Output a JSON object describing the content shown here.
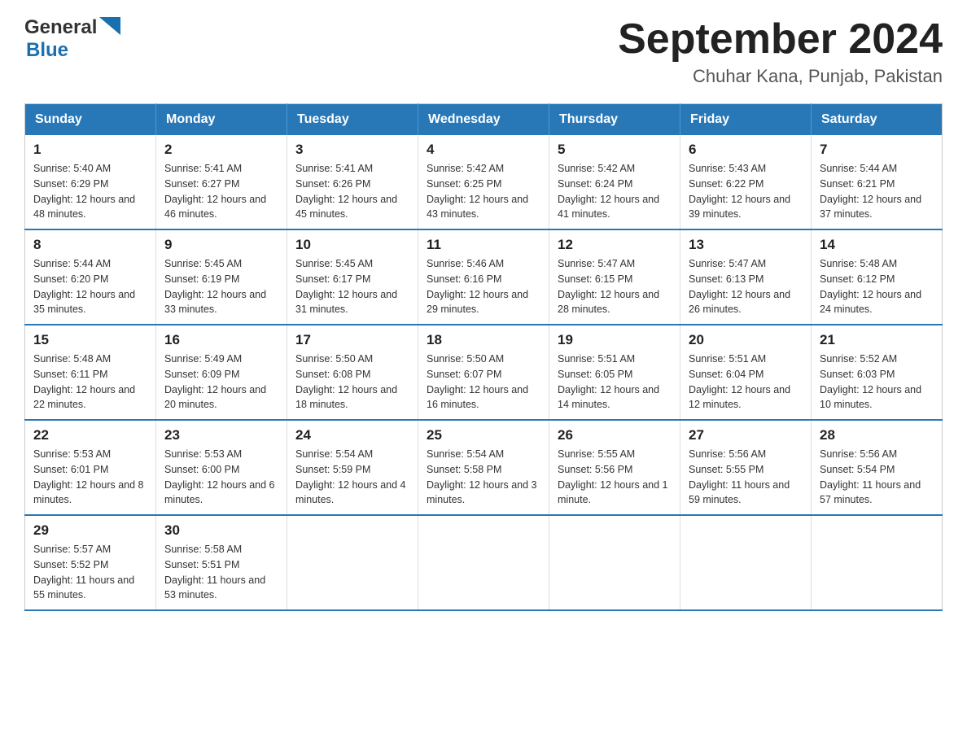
{
  "header": {
    "title": "September 2024",
    "location": "Chuhar Kana, Punjab, Pakistan",
    "logo_general": "General",
    "logo_blue": "Blue"
  },
  "days_of_week": [
    "Sunday",
    "Monday",
    "Tuesday",
    "Wednesday",
    "Thursday",
    "Friday",
    "Saturday"
  ],
  "weeks": [
    [
      {
        "day": "1",
        "sunrise": "Sunrise: 5:40 AM",
        "sunset": "Sunset: 6:29 PM",
        "daylight": "Daylight: 12 hours and 48 minutes."
      },
      {
        "day": "2",
        "sunrise": "Sunrise: 5:41 AM",
        "sunset": "Sunset: 6:27 PM",
        "daylight": "Daylight: 12 hours and 46 minutes."
      },
      {
        "day": "3",
        "sunrise": "Sunrise: 5:41 AM",
        "sunset": "Sunset: 6:26 PM",
        "daylight": "Daylight: 12 hours and 45 minutes."
      },
      {
        "day": "4",
        "sunrise": "Sunrise: 5:42 AM",
        "sunset": "Sunset: 6:25 PM",
        "daylight": "Daylight: 12 hours and 43 minutes."
      },
      {
        "day": "5",
        "sunrise": "Sunrise: 5:42 AM",
        "sunset": "Sunset: 6:24 PM",
        "daylight": "Daylight: 12 hours and 41 minutes."
      },
      {
        "day": "6",
        "sunrise": "Sunrise: 5:43 AM",
        "sunset": "Sunset: 6:22 PM",
        "daylight": "Daylight: 12 hours and 39 minutes."
      },
      {
        "day": "7",
        "sunrise": "Sunrise: 5:44 AM",
        "sunset": "Sunset: 6:21 PM",
        "daylight": "Daylight: 12 hours and 37 minutes."
      }
    ],
    [
      {
        "day": "8",
        "sunrise": "Sunrise: 5:44 AM",
        "sunset": "Sunset: 6:20 PM",
        "daylight": "Daylight: 12 hours and 35 minutes."
      },
      {
        "day": "9",
        "sunrise": "Sunrise: 5:45 AM",
        "sunset": "Sunset: 6:19 PM",
        "daylight": "Daylight: 12 hours and 33 minutes."
      },
      {
        "day": "10",
        "sunrise": "Sunrise: 5:45 AM",
        "sunset": "Sunset: 6:17 PM",
        "daylight": "Daylight: 12 hours and 31 minutes."
      },
      {
        "day": "11",
        "sunrise": "Sunrise: 5:46 AM",
        "sunset": "Sunset: 6:16 PM",
        "daylight": "Daylight: 12 hours and 29 minutes."
      },
      {
        "day": "12",
        "sunrise": "Sunrise: 5:47 AM",
        "sunset": "Sunset: 6:15 PM",
        "daylight": "Daylight: 12 hours and 28 minutes."
      },
      {
        "day": "13",
        "sunrise": "Sunrise: 5:47 AM",
        "sunset": "Sunset: 6:13 PM",
        "daylight": "Daylight: 12 hours and 26 minutes."
      },
      {
        "day": "14",
        "sunrise": "Sunrise: 5:48 AM",
        "sunset": "Sunset: 6:12 PM",
        "daylight": "Daylight: 12 hours and 24 minutes."
      }
    ],
    [
      {
        "day": "15",
        "sunrise": "Sunrise: 5:48 AM",
        "sunset": "Sunset: 6:11 PM",
        "daylight": "Daylight: 12 hours and 22 minutes."
      },
      {
        "day": "16",
        "sunrise": "Sunrise: 5:49 AM",
        "sunset": "Sunset: 6:09 PM",
        "daylight": "Daylight: 12 hours and 20 minutes."
      },
      {
        "day": "17",
        "sunrise": "Sunrise: 5:50 AM",
        "sunset": "Sunset: 6:08 PM",
        "daylight": "Daylight: 12 hours and 18 minutes."
      },
      {
        "day": "18",
        "sunrise": "Sunrise: 5:50 AM",
        "sunset": "Sunset: 6:07 PM",
        "daylight": "Daylight: 12 hours and 16 minutes."
      },
      {
        "day": "19",
        "sunrise": "Sunrise: 5:51 AM",
        "sunset": "Sunset: 6:05 PM",
        "daylight": "Daylight: 12 hours and 14 minutes."
      },
      {
        "day": "20",
        "sunrise": "Sunrise: 5:51 AM",
        "sunset": "Sunset: 6:04 PM",
        "daylight": "Daylight: 12 hours and 12 minutes."
      },
      {
        "day": "21",
        "sunrise": "Sunrise: 5:52 AM",
        "sunset": "Sunset: 6:03 PM",
        "daylight": "Daylight: 12 hours and 10 minutes."
      }
    ],
    [
      {
        "day": "22",
        "sunrise": "Sunrise: 5:53 AM",
        "sunset": "Sunset: 6:01 PM",
        "daylight": "Daylight: 12 hours and 8 minutes."
      },
      {
        "day": "23",
        "sunrise": "Sunrise: 5:53 AM",
        "sunset": "Sunset: 6:00 PM",
        "daylight": "Daylight: 12 hours and 6 minutes."
      },
      {
        "day": "24",
        "sunrise": "Sunrise: 5:54 AM",
        "sunset": "Sunset: 5:59 PM",
        "daylight": "Daylight: 12 hours and 4 minutes."
      },
      {
        "day": "25",
        "sunrise": "Sunrise: 5:54 AM",
        "sunset": "Sunset: 5:58 PM",
        "daylight": "Daylight: 12 hours and 3 minutes."
      },
      {
        "day": "26",
        "sunrise": "Sunrise: 5:55 AM",
        "sunset": "Sunset: 5:56 PM",
        "daylight": "Daylight: 12 hours and 1 minute."
      },
      {
        "day": "27",
        "sunrise": "Sunrise: 5:56 AM",
        "sunset": "Sunset: 5:55 PM",
        "daylight": "Daylight: 11 hours and 59 minutes."
      },
      {
        "day": "28",
        "sunrise": "Sunrise: 5:56 AM",
        "sunset": "Sunset: 5:54 PM",
        "daylight": "Daylight: 11 hours and 57 minutes."
      }
    ],
    [
      {
        "day": "29",
        "sunrise": "Sunrise: 5:57 AM",
        "sunset": "Sunset: 5:52 PM",
        "daylight": "Daylight: 11 hours and 55 minutes."
      },
      {
        "day": "30",
        "sunrise": "Sunrise: 5:58 AM",
        "sunset": "Sunset: 5:51 PM",
        "daylight": "Daylight: 11 hours and 53 minutes."
      },
      null,
      null,
      null,
      null,
      null
    ]
  ]
}
